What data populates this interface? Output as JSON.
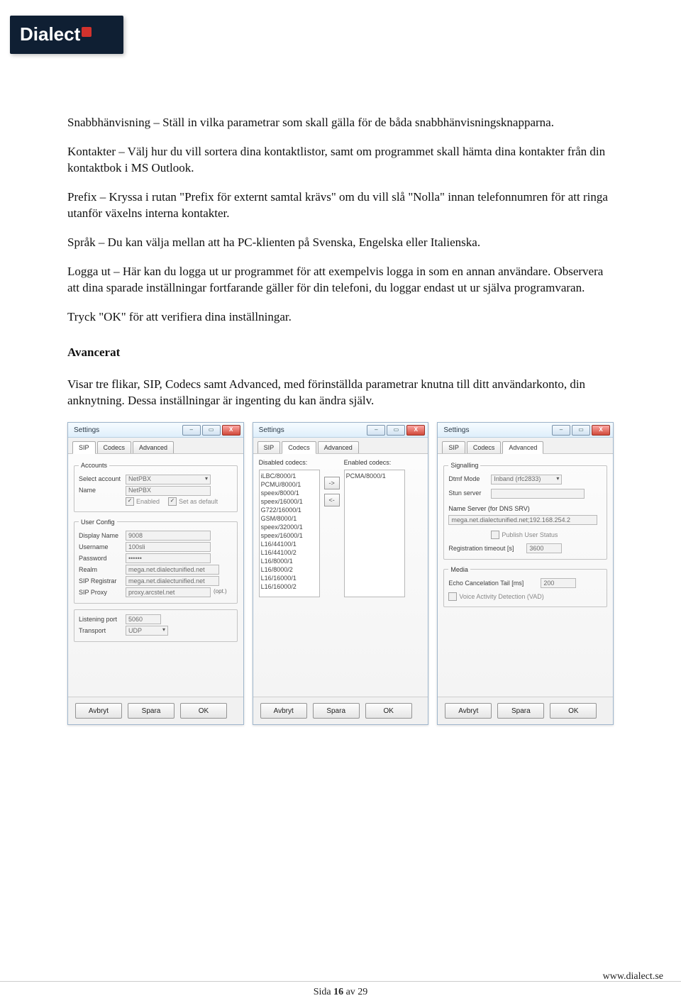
{
  "logo_text": "Dialect",
  "paragraphs": {
    "p1": "Snabbhänvisning – Ställ in vilka parametrar som skall gälla för de båda snabbhänvisningsknapparna.",
    "p2": "Kontakter – Välj hur du vill sortera dina kontaktlistor, samt om programmet skall hämta dina kontakter från din kontaktbok i MS Outlook.",
    "p3": "Prefix – Kryssa i rutan \"Prefix för externt samtal krävs\" om du vill slå \"Nolla\" innan telefonnumren för att ringa utanför växelns interna kontakter.",
    "p4": "Språk – Du kan välja mellan att ha PC-klienten på Svenska, Engelska eller Italienska.",
    "p5": "Logga ut – Här kan du logga ut ur programmet för att exempelvis logga in som en annan användare. Observera att dina sparade inställningar fortfarande gäller för din telefoni, du loggar endast ut ur själva programvaran.",
    "p6": "Tryck \"OK\" för att verifiera dina inställningar.",
    "h_advanced": "Avancerat",
    "p7": "Visar tre flikar, SIP, Codecs samt Advanced, med förinställda parametrar knutna till ditt användarkonto, din anknytning. Dessa inställningar är ingenting du kan ändra själv."
  },
  "dialog_common": {
    "title": "Settings",
    "tabs": [
      "SIP",
      "Codecs",
      "Advanced"
    ],
    "buttons": {
      "cancel": "Avbryt",
      "save": "Spara",
      "ok": "OK"
    }
  },
  "dlg_sip": {
    "groups": {
      "accounts": {
        "legend": "Accounts",
        "select_account_label": "Select account",
        "select_account_value": "NetPBX",
        "name_label": "Name",
        "name_value": "NetPBX",
        "enabled_label": "Enabled",
        "default_label": "Set as default"
      },
      "user_config": {
        "legend": "User Config",
        "display_name_label": "Display Name",
        "display_name_value": "9008",
        "username_label": "Username",
        "username_value": "100sli",
        "password_label": "Password",
        "password_value": "••••••",
        "realm_label": "Realm",
        "realm_value": "mega.net.dialectunified.net",
        "registrar_label": "SIP Registrar",
        "registrar_value": "mega.net.dialectunified.net",
        "proxy_label": "SIP Proxy",
        "proxy_value": "proxy.arcstel.net",
        "proxy_note": "(opt.)"
      },
      "transport": {
        "listening_port_label": "Listening port",
        "listening_port_value": "5060",
        "transport_label": "Transport",
        "transport_value": "UDP"
      }
    }
  },
  "dlg_codecs": {
    "disabled_label": "Disabled codecs:",
    "enabled_label": "Enabled codecs:",
    "disabled_list": [
      "iLBC/8000/1",
      "PCMU/8000/1",
      "speex/8000/1",
      "speex/16000/1",
      "G722/16000/1",
      "GSM/8000/1",
      "speex/32000/1",
      "speex/16000/1",
      "L16/44100/1",
      "L16/44100/2",
      "L16/8000/1",
      "L16/8000/2",
      "L16/16000/1",
      "L16/16000/2"
    ],
    "enabled_list": [
      "PCMA/8000/1"
    ]
  },
  "dlg_advanced": {
    "signalling": {
      "legend": "Signalling",
      "dtmf_label": "Dtmf Mode",
      "dtmf_value": "Inband (rfc2833)",
      "stun_label": "Stun server",
      "nameserver_label": "Name Server (for DNS SRV)",
      "nameserver_value": "mega.net.dialectunified.net;192.168.254.2",
      "publish_label": "Publish User Status",
      "regtimeout_label": "Registration timeout [s]",
      "regtimeout_value": "3600"
    },
    "media": {
      "legend": "Media",
      "echo_label": "Echo Cancelation Tail [ms]",
      "echo_value": "200",
      "vad_label": "Voice Activity Detection (VAD)"
    }
  },
  "footer": {
    "page_label": "Sida 16 av 29",
    "url": "www.dialect.se"
  }
}
